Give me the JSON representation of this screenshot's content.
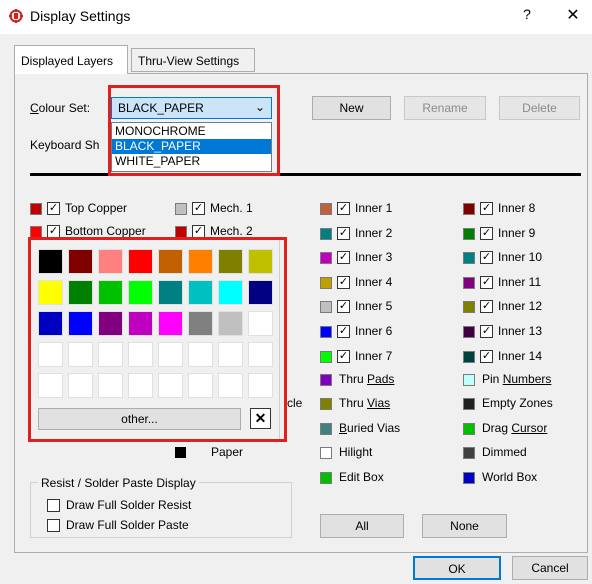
{
  "window": {
    "title": "Display Settings",
    "help_glyph": "?",
    "close_glyph": "✕",
    "icon": "app-gear-icon"
  },
  "tabs": [
    {
      "label": "Displayed Layers",
      "active": true
    },
    {
      "label": "Thru-View Settings",
      "active": false
    }
  ],
  "colour_set": {
    "label": "Colour Set:",
    "value": "BLACK_PAPER",
    "options": [
      "MONOCHROME",
      "BLACK_PAPER",
      "WHITE_PAPER"
    ],
    "selected_option": "BLACK_PAPER"
  },
  "set_buttons": {
    "new": "New",
    "rename": "Rename",
    "delete": "Delete"
  },
  "keyboard_label": "Keyboard Sh",
  "layers": {
    "col1": [
      {
        "label": "Top Copper",
        "color": "#c00000"
      },
      {
        "label": "Bottom Copper",
        "color": "#ff0000"
      }
    ],
    "col2": [
      {
        "label": "Mech. 1",
        "color": "#c0c0c0"
      },
      {
        "label": "Mech. 2",
        "color": "#c00000"
      }
    ],
    "col3": [
      {
        "label": "Inner 1",
        "color": "#c06040"
      },
      {
        "label": "Inner 2",
        "color": "#008080"
      },
      {
        "label": "Inner 3",
        "color": "#c000c0"
      },
      {
        "label": "Inner 4",
        "color": "#c0a000"
      },
      {
        "label": "Inner 5",
        "color": "#c0c0c0"
      },
      {
        "label": "Inner 6",
        "color": "#0000ff"
      },
      {
        "label": "Inner 7",
        "color": "#00ff00"
      }
    ],
    "col4": [
      {
        "label": "Inner 8",
        "color": "#800000"
      },
      {
        "label": "Inner 9",
        "color": "#008000"
      },
      {
        "label": "Inner 10",
        "color": "#008080"
      },
      {
        "label": "Inner 11",
        "color": "#800080"
      },
      {
        "label": "Inner 12",
        "color": "#808000"
      },
      {
        "label": "Inner 13",
        "color": "#400040"
      },
      {
        "label": "Inner 14",
        "color": "#004040"
      }
    ]
  },
  "items": {
    "col3": [
      {
        "label": "Thru Pads",
        "underline": "P",
        "color": "#8000c0"
      },
      {
        "label": "Thru Vias",
        "underline": "V",
        "color": "#808000"
      },
      {
        "label": "Buried Vias",
        "underline": "B",
        "color": "#408080"
      },
      {
        "label": "Hilight",
        "underline": "",
        "color": "#ffffff"
      },
      {
        "label": "Edit Box",
        "underline": "",
        "color": "#00c000"
      }
    ],
    "col4": [
      {
        "label": "Pin Numbers",
        "underline": "N",
        "color": "#c0ffff"
      },
      {
        "label": "Empty Zones",
        "underline": "",
        "color": "#202020"
      },
      {
        "label": "Drag Cursor",
        "underline": "C",
        "color": "#00c000"
      },
      {
        "label": "Dimmed",
        "underline": "",
        "color": "#404040"
      },
      {
        "label": "World Box",
        "underline": "",
        "color": "#0000c0"
      }
    ]
  },
  "partial_label": "cle",
  "paper": {
    "label": "Paper",
    "color": "#000000"
  },
  "palette": {
    "colors": [
      [
        "#000000",
        "#800000",
        "#ff8080",
        "#ff0000",
        "#c06000",
        "#ff8000",
        "#808000",
        "#c0c000"
      ],
      [
        "#ffff00",
        "#008000",
        "#00c000",
        "#00ff00",
        "#008080",
        "#00c0c0",
        "#00ffff",
        "#000080"
      ],
      [
        "#0000c0",
        "#0000ff",
        "#800080",
        "#c000c0",
        "#ff00ff",
        "#808080",
        "#c0c0c0",
        "#ffffff"
      ],
      [
        "#ffffff",
        "#ffffff",
        "#ffffff",
        "#ffffff",
        "#ffffff",
        "#ffffff",
        "#ffffff",
        "#ffffff"
      ],
      [
        "#ffffff",
        "#ffffff",
        "#ffffff",
        "#ffffff",
        "#ffffff",
        "#ffffff",
        "#ffffff",
        "#ffffff"
      ]
    ],
    "other_label": "other...",
    "close_glyph": "✕"
  },
  "resist": {
    "title": "Resist / Solder Paste Display",
    "options": [
      "Draw Full Solder Resist",
      "Draw Full Solder Paste"
    ]
  },
  "bottom_buttons": {
    "all": "All",
    "none": "None",
    "ok": "OK",
    "cancel": "Cancel"
  }
}
